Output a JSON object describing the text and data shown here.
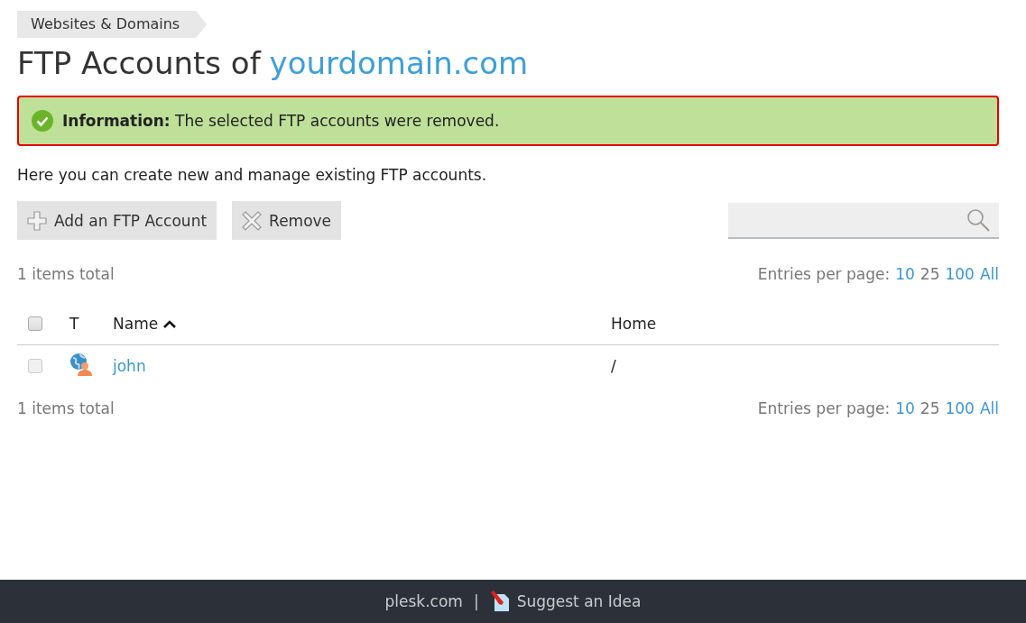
{
  "breadcrumb": "Websites & Domains",
  "title": {
    "text": "FTP Accounts of",
    "domain": "yourdomain.com"
  },
  "message": {
    "kind": "success",
    "label": "Information:",
    "text": "The selected FTP accounts were removed."
  },
  "description": "Here you can create new and manage existing FTP accounts.",
  "toolbar": {
    "buttons": [
      {
        "label": "Add an FTP Account",
        "kind": "add"
      },
      {
        "label": "Remove",
        "kind": "remove"
      }
    ]
  },
  "list_top": {
    "total": "1 items total",
    "per_page_label": "Entries per page:",
    "per_page": [
      {
        "label": "10",
        "selected": false
      },
      {
        "label": "25",
        "selected": true
      },
      {
        "label": "100",
        "selected": false
      },
      {
        "label": "All",
        "selected": false
      }
    ]
  },
  "table": {
    "header_checkbox": {
      "checked": false
    },
    "columns": [
      {
        "label": "T",
        "sorted_ascending": false
      },
      {
        "label": "Name",
        "sorted_ascending": true
      },
      {
        "label": "Home",
        "sorted_ascending": false
      }
    ],
    "rows": [
      {
        "checked": false,
        "kind": "user",
        "name": "john",
        "home": "/"
      }
    ]
  },
  "list_bottom": {
    "total": "1 items total",
    "per_page_label": "Entries per page:",
    "per_page": [
      {
        "label": "10",
        "selected": false
      },
      {
        "label": "25",
        "selected": true
      },
      {
        "label": "100",
        "selected": false
      },
      {
        "label": "All",
        "selected": false
      }
    ]
  },
  "footer": {
    "links": [
      {
        "label": "plesk.com",
        "kind": "plain"
      },
      {
        "label": "Suggest an Idea",
        "kind": "idea"
      }
    ],
    "separator": "|"
  }
}
